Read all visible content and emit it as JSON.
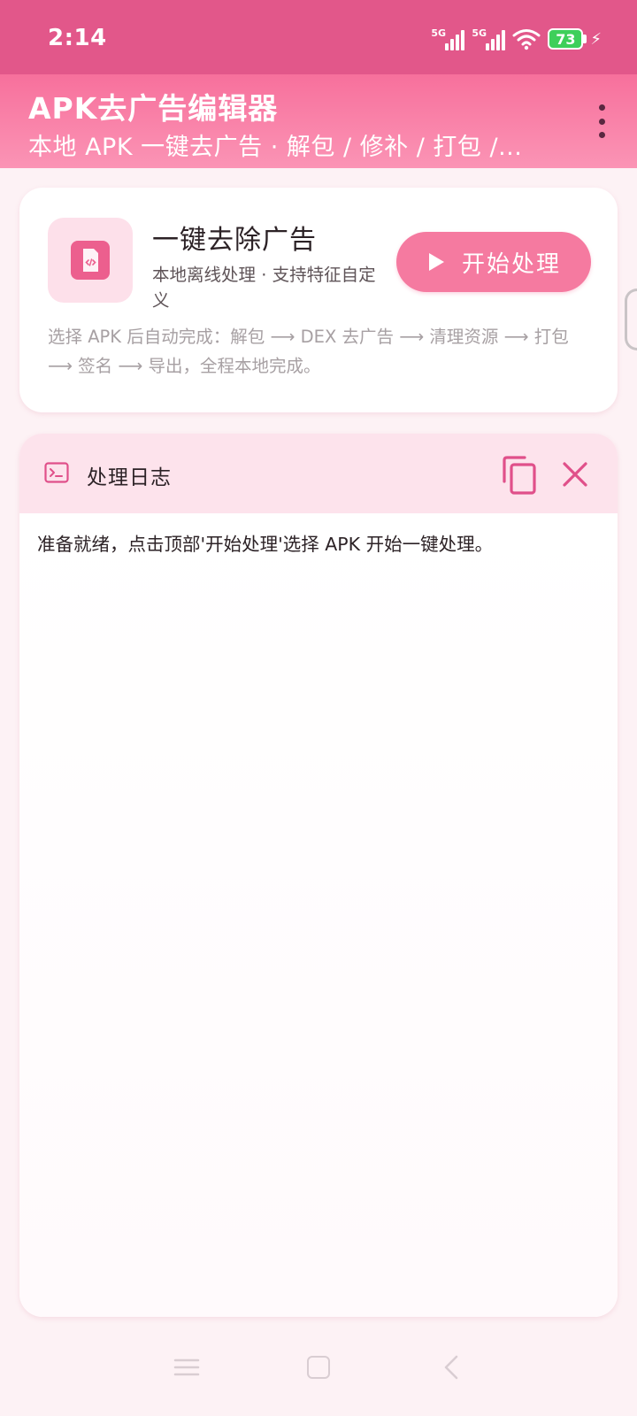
{
  "status_bar": {
    "time": "2:14",
    "sim1_label": "5G",
    "sim2_label": "5G",
    "battery_level": "73",
    "charging": true,
    "color": "#e2578a"
  },
  "app_bar": {
    "title": "APK去广告编辑器",
    "subtitle": "本地 APK 一键去广告 · 解包 / 修补 / 打包 /...",
    "more_icon": "more-vert-icon"
  },
  "action_card": {
    "icon": "apk-file-icon",
    "title": "一键去除广告",
    "description": "本地离线处理 · 支持特征自定义",
    "start_button_label": "开始处理",
    "start_button_icon": "play-icon",
    "note": "选择 APK 后自动完成：解包 ⟶ DEX 去广告 ⟶ 清理资源 ⟶ 打包 ⟶ 签名 ⟶ 导出，全程本地完成。"
  },
  "log_card": {
    "title": "处理日志",
    "icon": "terminal-icon",
    "copy_icon": "copy-icon",
    "close_icon": "close-icon",
    "log_text": "准备就绪，点击顶部'开始处理'选择 APK 开始一键处理。"
  },
  "nav_bar": {
    "menu_icon": "menu-icon",
    "home_icon": "home-icon",
    "back_icon": "back-icon"
  },
  "colors": {
    "accent": "#f57aa0",
    "app_bar_top": "#f7709c",
    "background": "#fdf2f5",
    "log_header": "#fde3ec"
  }
}
